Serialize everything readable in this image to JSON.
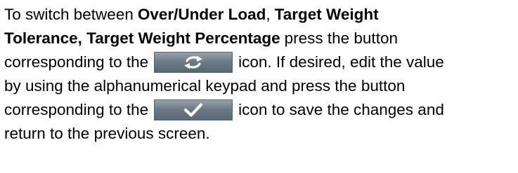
{
  "paragraph": {
    "l1_a": "To switch between",
    "l1_b": "Over/Under Load",
    "l1_c": ",",
    "l1_d": "Target Weight",
    "l2_a": "Tolerance, Target Weight Percentage",
    "l2_b": "press the button",
    "l3_a": "corresponding to the",
    "l3_b": "icon. If desired, edit the value",
    "l4": "by using the alphanumerical keypad and press the button",
    "l5_a": "corresponding to the",
    "l5_b": "icon to save the changes and",
    "l6": "return to the previous screen."
  },
  "icons": {
    "switch": "refresh-arrows-icon",
    "confirm": "checkmark-icon"
  },
  "colors": {
    "button_top": "#97a5ae",
    "button_bottom": "#58676f",
    "icon": "#ffffff"
  }
}
